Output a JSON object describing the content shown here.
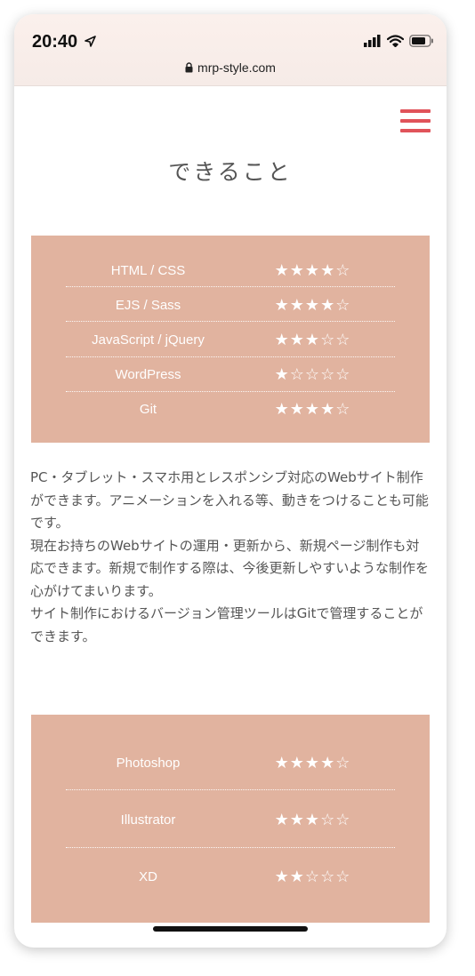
{
  "status_bar": {
    "time": "20:40",
    "url": "mrp-style.com",
    "icons": [
      "location-arrow-icon",
      "cellular-signal-icon",
      "wifi-icon",
      "battery-icon",
      "lock-icon"
    ]
  },
  "header": {
    "menu_icon": "hamburger-menu-icon",
    "menu_color": "#e0535a"
  },
  "page_title": "できること",
  "skills_web": [
    {
      "name": "HTML / CSS",
      "stars": "★★★★☆",
      "rating": 4
    },
    {
      "name": "EJS / Sass",
      "stars": "★★★★☆",
      "rating": 4
    },
    {
      "name": "JavaScript / jQuery",
      "stars": "★★★☆☆",
      "rating": 3
    },
    {
      "name": "WordPress",
      "stars": "★☆☆☆☆",
      "rating": 1
    },
    {
      "name": "Git",
      "stars": "★★★★☆",
      "rating": 4
    }
  ],
  "description": [
    "PC・タブレット・スマホ用とレスポンシブ対応のWebサイト制作ができます。アニメーションを入れる等、動きをつけることも可能です。",
    "現在お持ちのWebサイトの運用・更新から、新規ページ制作も対応できます。新規で制作する際は、今後更新しやすいような制作を心がけてまいります。",
    "サイト制作におけるバージョン管理ツールはGitで管理することができます。"
  ],
  "skills_design": [
    {
      "name": "Photoshop",
      "stars": "★★★★☆",
      "rating": 4
    },
    {
      "name": "Illustrator",
      "stars": "★★★☆☆",
      "rating": 3
    },
    {
      "name": "XD",
      "stars": "★★☆☆☆",
      "rating": 2
    }
  ],
  "colors": {
    "skill_box_bg": "#e1b39f",
    "accent": "#e0535a",
    "text": "#555555"
  }
}
